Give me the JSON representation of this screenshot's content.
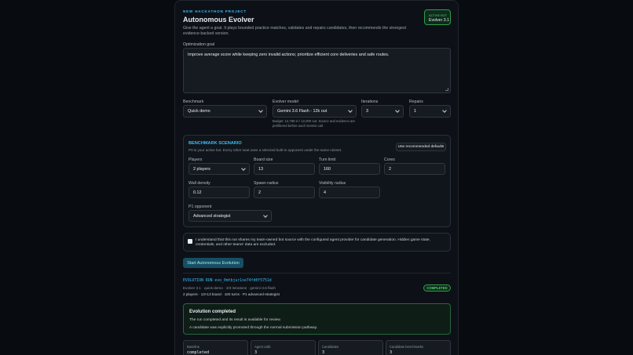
{
  "header": {
    "eyebrow": "NEW HACKATHON PROJECT",
    "title": "Autonomous Evolver",
    "description": "Give the agent a goal. It plays bounded practice matches, validates and repairs candidates, then recommends the strongest evidence-backed version.",
    "active_bot_label": "ACTIVE BOT",
    "active_bot_value": "Evolver 3.1"
  },
  "goal": {
    "label": "Optimization goal",
    "value": "Improve average score while keeping zero invalid actions; prioritize efficient core deliveries and safe routes."
  },
  "settings": {
    "benchmark_label": "Benchmark",
    "benchmark_value": "Quick demo",
    "model_label": "Evolver model",
    "model_value": "Gemini 3.6 Flash - 12k out",
    "model_hint": "Budget: 12,768 in / 12,000 out. Source and evidence are prefiltered before each Gemini call.",
    "iterations_label": "Iterations",
    "iterations_value": "3",
    "repairs_label": "Repairs",
    "repairs_value": "1"
  },
  "scenario": {
    "title": "BENCHMARK SCENARIO",
    "description": "P0 is your active bot. Every other seat uses a selected built-in opponent under the same ruleset.",
    "recommended_button": "Use recommended defaults",
    "players_label": "Players",
    "players_value": "2 players",
    "board_size_label": "Board size",
    "board_size_value": "13",
    "turn_limit_label": "Turn limit",
    "turn_limit_value": "160",
    "cores_label": "Cores",
    "cores_value": "2",
    "wall_density_label": "Wall density",
    "wall_density_value": "0.12",
    "spawn_radius_label": "Spawn radius",
    "spawn_radius_value": "2",
    "visibility_radius_label": "Visibility radius",
    "visibility_radius_value": "4",
    "opponent_label": "P1 opponent",
    "opponent_value": "Advanced strategist"
  },
  "consent": {
    "text": "I understand that this run shares my team-owned bot source with the configured agent provider for candidate generation. Hidden game state, credentials, and other teams' data are excluded."
  },
  "start_button": "Start Autonomous Evolution",
  "run": {
    "id_label": "EVOLUTION RUN evo_0mtbjur1se74fd0f5751d",
    "meta_line1": "Evolver 3.1 · quick-demo · 3/3 iterations · gemini-3.6-flash",
    "meta_line2": "2 players · 13×13 board · 160 turns · P1 advanced-strategist",
    "status": "COMPLETED"
  },
  "result": {
    "title": "Evolution completed",
    "line1": "The run completed and its result is available for review.",
    "line2": "A candidate was explicitly promoted through the normal submission pathway."
  },
  "stats": [
    {
      "label": "Baseline",
      "value": "completed"
    },
    {
      "label": "Agent calls",
      "value": "3"
    },
    {
      "label": "Candidates",
      "value": "3"
    },
    {
      "label": "Candidate benchmarks",
      "value": "3"
    }
  ],
  "colors": {
    "accent": "#38bdf8",
    "success": "#56d364",
    "background": "#080b10",
    "panel": "#0d1117"
  }
}
